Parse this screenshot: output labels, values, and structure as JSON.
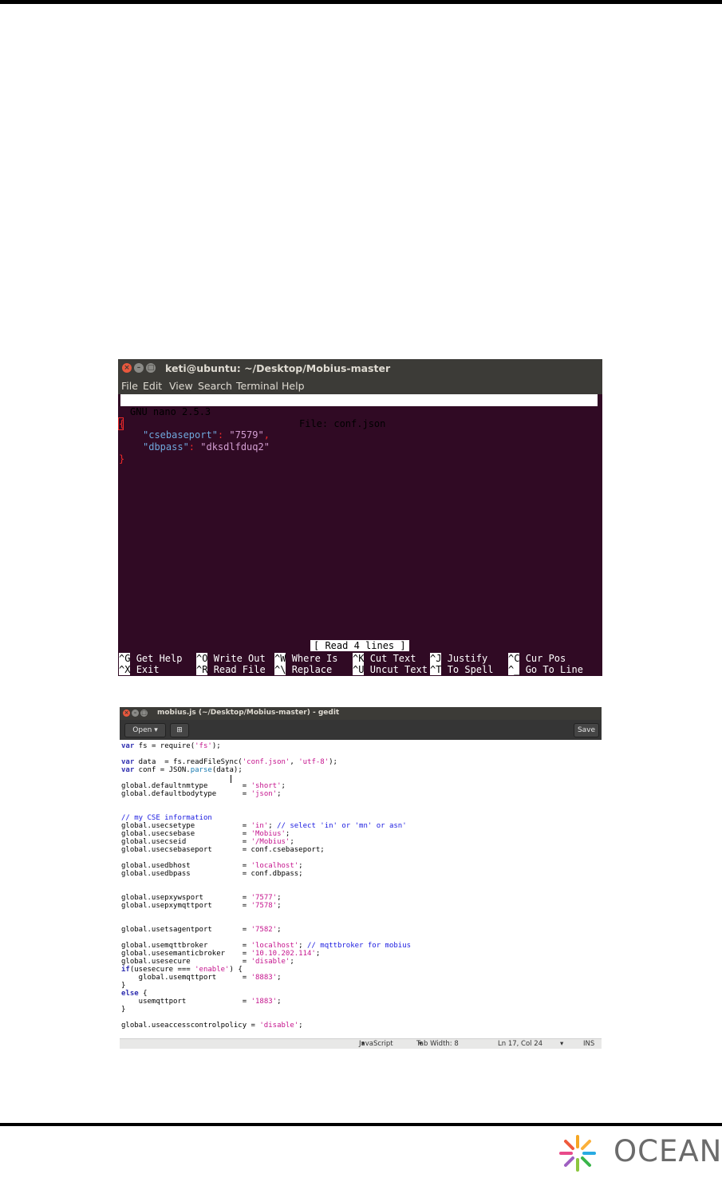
{
  "terminal": {
    "title": "keti@ubuntu: ~/Desktop/Mobius-master",
    "menu": [
      "File",
      "Edit",
      "View",
      "Search",
      "Terminal",
      "Help"
    ],
    "nano_version": "GNU nano 2.5.3",
    "nano_file": "File: conf.json",
    "content": {
      "open_brace": "{",
      "csebaseport_key": "\"csebaseport\"",
      "csebaseport_value": "\"7579\"",
      "dbpass_key": "\"dbpass\"",
      "dbpass_value": "\"dksdlfduq2\"",
      "close_brace": "}"
    },
    "status": "[ Read 4 lines ]",
    "shortcuts": [
      {
        "key": "^G",
        "label": "Get Help"
      },
      {
        "key": "^O",
        "label": "Write Out"
      },
      {
        "key": "^W",
        "label": "Where Is"
      },
      {
        "key": "^K",
        "label": "Cut Text"
      },
      {
        "key": "^J",
        "label": "Justify"
      },
      {
        "key": "^C",
        "label": "Cur Pos"
      },
      {
        "key": "^X",
        "label": "Exit"
      },
      {
        "key": "^R",
        "label": "Read File"
      },
      {
        "key": "^\\",
        "label": "Replace"
      },
      {
        "key": "^U",
        "label": "Uncut Text"
      },
      {
        "key": "^T",
        "label": "To Spell"
      },
      {
        "key": "^_",
        "label": "Go To Line"
      }
    ]
  },
  "gedit": {
    "title": "mobius.js (~/Desktop/Mobius-master) - gedit",
    "open_label": "Open",
    "save_label": "Save",
    "status": {
      "language": "JavaScript",
      "tab_width": "Tab Width: 8",
      "position": "Ln 17, Col 24",
      "mode": "INS"
    }
  },
  "logo": {
    "text": "OCEAN"
  }
}
